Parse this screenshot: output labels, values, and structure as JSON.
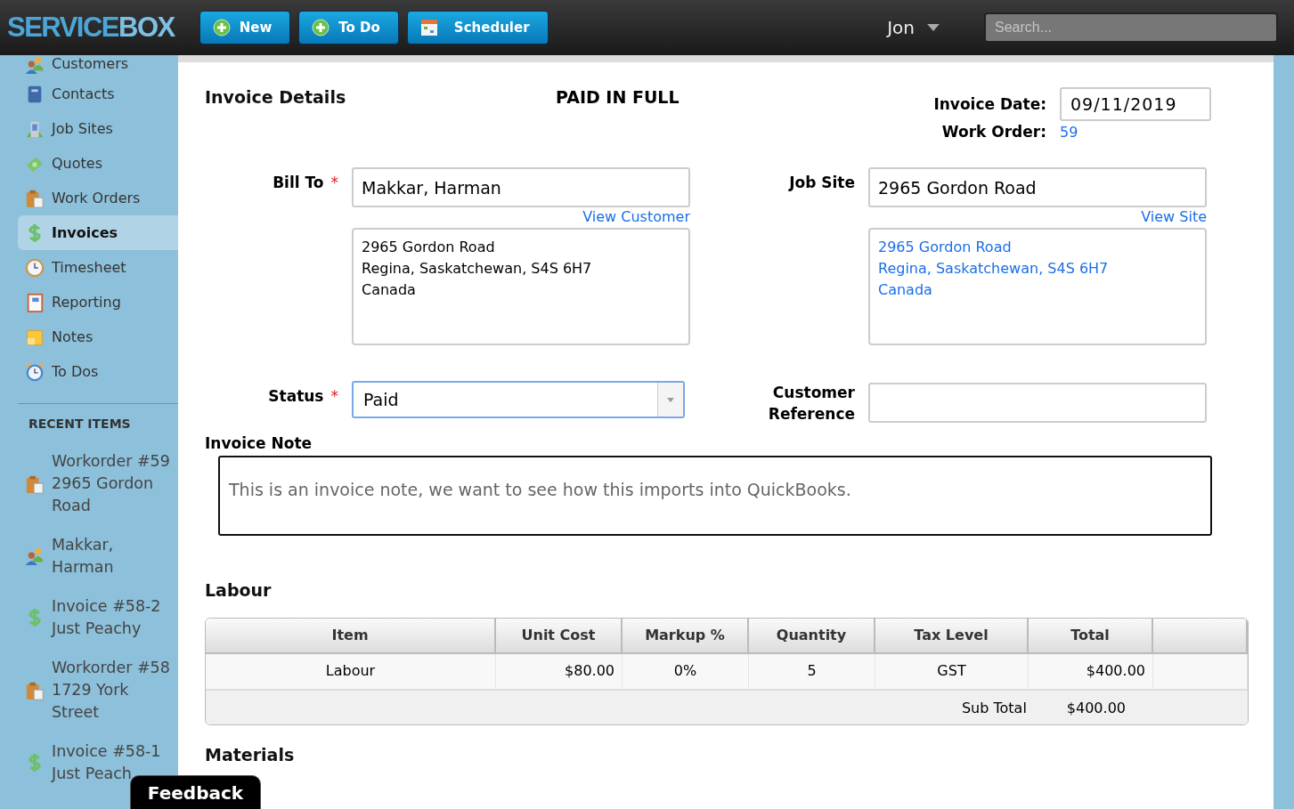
{
  "app": {
    "logo_part1": "SERVICE",
    "logo_part2": "BOX"
  },
  "toolbar": {
    "buttons": [
      {
        "label": "New",
        "kind": "plus"
      },
      {
        "label": "To Do",
        "kind": "plus"
      },
      {
        "label": "Scheduler",
        "kind": "calendar"
      }
    ],
    "user": "Jon",
    "search": {
      "placeholder": "Search..."
    }
  },
  "sidebar": {
    "items": [
      {
        "label": "Customers",
        "kind": "people",
        "selected": false
      },
      {
        "label": "Contacts",
        "kind": "book",
        "selected": false
      },
      {
        "label": "Job Sites",
        "kind": "building",
        "selected": false
      },
      {
        "label": "Quotes",
        "kind": "money",
        "selected": false
      },
      {
        "label": "Work Orders",
        "kind": "clipboard",
        "selected": false
      },
      {
        "label": "Invoices",
        "kind": "dollar",
        "selected": true
      },
      {
        "label": "Timesheet",
        "kind": "clock",
        "selected": false
      },
      {
        "label": "Reporting",
        "kind": "report",
        "selected": false
      },
      {
        "label": "Notes",
        "kind": "note",
        "selected": false
      },
      {
        "label": "To Dos",
        "kind": "alarm",
        "selected": false
      }
    ],
    "recent_heading": "RECENT ITEMS",
    "recent_items": [
      {
        "lines": [
          "Workorder #59",
          "2965 Gordon",
          "Road"
        ],
        "kind": "clipboard"
      },
      {
        "lines": [
          "Makkar,",
          "Harman"
        ],
        "kind": "people"
      },
      {
        "lines": [
          "Invoice #58-2",
          "Just Peachy"
        ],
        "kind": "dollar"
      },
      {
        "lines": [
          "Workorder #58",
          "1729 York",
          "Street"
        ],
        "kind": "clipboard"
      },
      {
        "lines": [
          "Invoice #58-1",
          "Just Peach"
        ],
        "kind": "dollar"
      }
    ]
  },
  "invoice": {
    "title": "Invoice Details",
    "status_banner": "PAID IN FULL",
    "invoice_date_label": "Invoice Date:",
    "invoice_date": "09/11/2019",
    "work_order_label": "Work Order:",
    "work_order": "59",
    "bill_to_label": "Bill To",
    "bill_to": "Makkar, Harman",
    "view_customer": "View Customer",
    "bill_address": [
      "2965 Gordon Road",
      "Regina, Saskatchewan, S4S 6H7",
      "Canada"
    ],
    "job_site_label": "Job Site",
    "job_site": "2965 Gordon Road",
    "view_site": "View Site",
    "site_address": [
      "2965 Gordon Road",
      "Regina, Saskatchewan, S4S 6H7",
      "Canada"
    ],
    "required_mark": "*",
    "status_label": "Status",
    "status": "Paid",
    "customer_reference_label": [
      "Customer",
      "Reference"
    ],
    "note_label": "Invoice Note",
    "note": "This is an invoice note, we want to see how this imports into QuickBooks."
  },
  "labour": {
    "title": "Labour",
    "columns": [
      "Item",
      "Unit Cost",
      "Markup %",
      "Quantity",
      "Tax Level",
      "Total"
    ],
    "rows": [
      [
        "Labour",
        "$80.00",
        "0%",
        "5",
        "GST",
        "$400.00"
      ]
    ],
    "subtotal_label": "Sub Total",
    "subtotal": "$400.00"
  },
  "materials": {
    "title": "Materials"
  },
  "feedback": "Feedback"
}
